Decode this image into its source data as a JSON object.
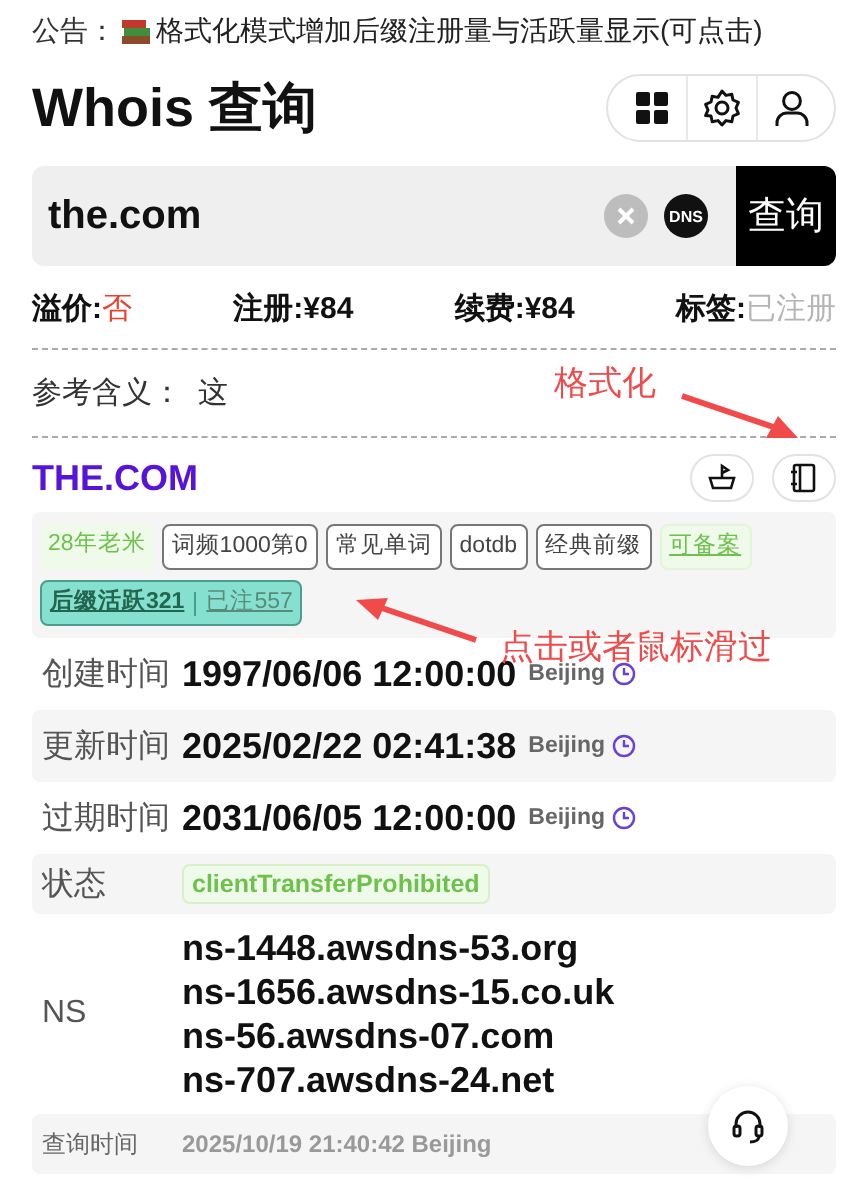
{
  "notice": {
    "label": "公告：",
    "text": "格式化模式增加后缀注册量与活跃量显示(可点击)"
  },
  "title": "Whois 查询",
  "search": {
    "value": "the.com",
    "dns_label": "DNS",
    "button": "查询"
  },
  "prices": [
    {
      "label": "溢价:",
      "value": "否",
      "color": "#e8412c"
    },
    {
      "label": "注册:",
      "value": "¥84",
      "color": "#111111"
    },
    {
      "label": "续费:",
      "value": "¥84",
      "color": "#111111"
    },
    {
      "label": "标签:",
      "value": "已注册",
      "color": "#b5b5b5"
    }
  ],
  "meaning": {
    "label": "参考含义：",
    "value": "这"
  },
  "domain": "THE.COM",
  "tags": [
    {
      "kind": "soft",
      "text": "28年老米"
    },
    {
      "kind": "outline",
      "text": "词频1000第0"
    },
    {
      "kind": "outline",
      "text": "常见单词"
    },
    {
      "kind": "outline",
      "text": "dotdb"
    },
    {
      "kind": "outline",
      "text": "经典前缀"
    },
    {
      "kind": "link",
      "text": "可备案"
    },
    {
      "kind": "suffix",
      "parts": [
        "后缀活跃321",
        "已注557"
      ]
    }
  ],
  "details": [
    {
      "kind": "time",
      "label": "创建时间",
      "value": "1997/06/06 12:00:00",
      "zone": "Beijing"
    },
    {
      "kind": "time",
      "label": "更新时间",
      "value": "2025/02/22 02:41:38",
      "zone": "Beijing"
    },
    {
      "kind": "time",
      "label": "过期时间",
      "value": "2031/06/05 12:00:00",
      "zone": "Beijing"
    },
    {
      "kind": "status",
      "label": "状态",
      "values": [
        "clientTransferProhibited"
      ]
    },
    {
      "kind": "list",
      "label": "NS",
      "values": [
        "ns-1448.awsdns-53.org",
        "ns-1656.awsdns-15.co.uk",
        "ns-56.awsdns-07.com",
        "ns-707.awsdns-24.net"
      ]
    },
    {
      "kind": "meta",
      "label": "查询时间",
      "value": "2025/10/19 21:40:42 Beijing"
    }
  ],
  "annotations": [
    {
      "text": "格式化"
    },
    {
      "text": "点击或者鼠标滑过"
    }
  ]
}
